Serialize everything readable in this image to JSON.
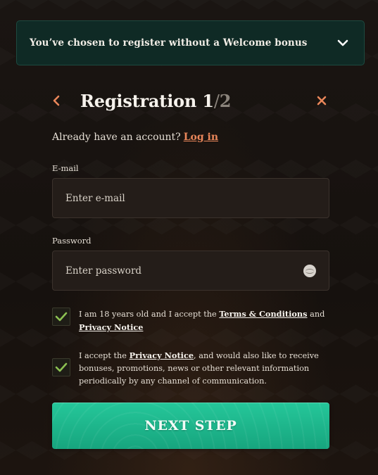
{
  "bonus_bar": {
    "text": "You’ve chosen to register without a Welcome bonus",
    "icon": "chevron-down-icon"
  },
  "header": {
    "title": "Registration 1",
    "slash": "/",
    "total": "2",
    "back_icon": "chevron-left-icon",
    "close_icon": "close-icon"
  },
  "account": {
    "prompt": "Already have an account?",
    "login_label": "Log in"
  },
  "email": {
    "label": "E-mail",
    "placeholder": "Enter e-mail",
    "value": ""
  },
  "password": {
    "label": "Password",
    "placeholder": "Enter password",
    "value": "",
    "toggle_icon": "eye-icon"
  },
  "consents": [
    {
      "checked": true,
      "text_a": "I am 18 years old and I accept the ",
      "link_a": "Terms & Conditions",
      "text_b": " and ",
      "link_b": "Privacy Notice"
    },
    {
      "checked": true,
      "text_a": "I accept the ",
      "link_a": "Privacy Notice",
      "text_b": ", and would also like to receive bonuses, promotions, news or other relevant information periodically by any channel of communication."
    }
  ],
  "next_button": {
    "label": "NEXT STEP"
  },
  "colors": {
    "accent_orange": "#e9865a",
    "accent_green": "#1fb98f",
    "check_green": "#8cc152",
    "bonus_bg": "#0f2a25"
  }
}
